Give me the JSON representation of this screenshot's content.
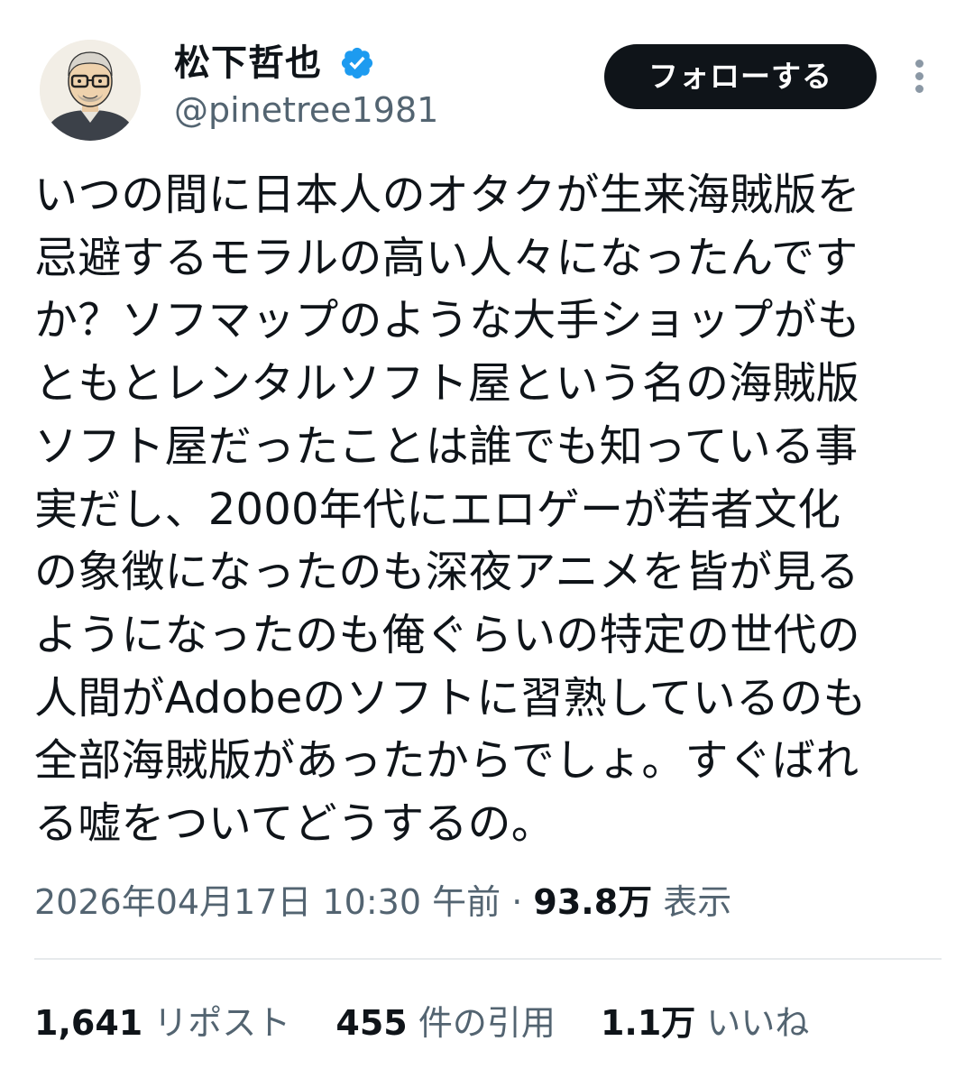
{
  "author": {
    "display_name": "松下哲也",
    "handle": "@pinetree1981",
    "verified": true,
    "avatar": "illustrated-man-with-glasses-avatar"
  },
  "actions": {
    "follow_label": "フォローする",
    "more_icon": "vertical-ellipsis-icon"
  },
  "tweet": {
    "lines": [
      "いつの間に日本人のオタクが生来海賊版を",
      "忌避するモラルの高い人々になったんです",
      "か？ソフマップのような大手ショップがも",
      "ともとレンタルソフト屋という名の海賊版",
      "ソフト屋だったことは誰でも知っている事",
      "実だし、2000年代にエロゲーが若者文化",
      "の象徴になったのも深夜アニメを皆が見る",
      "ようになったのも俺ぐらいの特定の世代の",
      "人間がAdobeのソフトに習熟しているのも",
      "全部海賊版があったからでしょ。すぐばれ",
      "る嘘をついてどうするの。"
    ]
  },
  "meta": {
    "timestamp": "2026年04月17日 10:30 午前",
    "separator": "·",
    "views_count": "93.8万",
    "views_label": "表示"
  },
  "stats": {
    "reposts": {
      "count": "1,641",
      "label": "リポスト"
    },
    "quotes": {
      "count": "455",
      "label": "件の引用"
    },
    "likes": {
      "count": "1.1万",
      "label": "いいね"
    }
  },
  "colors": {
    "text": "#0f1419",
    "secondary": "#536471",
    "verified": "#1d9bf0",
    "button_bg": "#0f1419",
    "divider": "#e7eaec"
  }
}
